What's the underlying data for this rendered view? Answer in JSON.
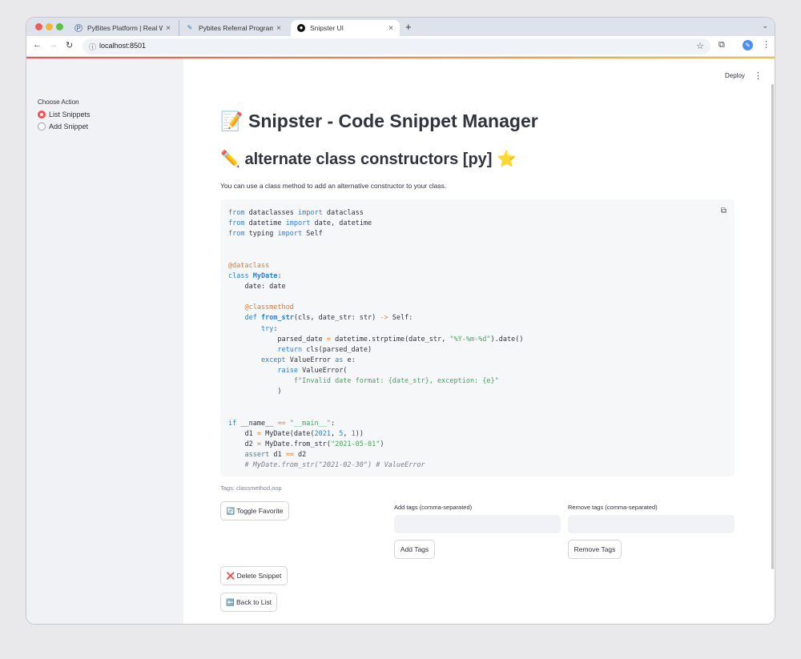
{
  "browser": {
    "tabs": [
      {
        "title": "PyBites Platform | Real World",
        "favicon": "pybites-logo-icon"
      },
      {
        "title": "Pybites Referral Program | Py",
        "favicon": "feather-icon"
      },
      {
        "title": "Snipster UI",
        "favicon": "github-icon"
      }
    ],
    "url": "localhost:8501",
    "icons": [
      "back-icon",
      "forward-icon",
      "reload-icon",
      "info-icon",
      "star-icon",
      "extensions-icon",
      "profile-icon",
      "menu-icon"
    ]
  },
  "sidebar": {
    "label": "Choose Action",
    "options": [
      {
        "label": "List Snippets",
        "selected": true
      },
      {
        "label": "Add Snippet",
        "selected": false
      }
    ]
  },
  "header": {
    "deploy_label": "Deploy"
  },
  "main": {
    "page_title": "📝 Snipster - Code Snippet Manager",
    "snippet_title": "✏️ alternate class constructors [py] ⭐",
    "description": "You can use a class method to add an alternative constructor to your class.",
    "code_lines": [
      "from dataclasses import dataclass",
      "from datetime import date, datetime",
      "from typing import Self",
      "",
      "",
      "@dataclass",
      "class MyDate:",
      "    date: date",
      "",
      "    @classmethod",
      "    def from_str(cls, date_str: str) -> Self:",
      "        try:",
      "            parsed_date = datetime.strptime(date_str, \"%Y-%m-%d\").date()",
      "            return cls(parsed_date)",
      "        except ValueError as e:",
      "            raise ValueError(",
      "                f\"Invalid date format: {date_str}, exception: {e}\"",
      "            )",
      "",
      "",
      "if __name__ == \"__main__\":",
      "    d1 = MyDate(date(2021, 5, 1))",
      "    d2 = MyDate.from_str(\"2021-05-01\")",
      "    assert d1 == d2",
      "    # MyDate.from_str(\"2021-02-30\") # ValueError"
    ],
    "tags_line": "Tags: classmethod,oop",
    "toggle_favorite_label": "🔄 Toggle Favorite",
    "add_tags_label": "Add tags (comma-separated)",
    "add_tags_value": "",
    "add_tags_button": "Add Tags",
    "remove_tags_label": "Remove tags (comma-separated)",
    "remove_tags_value": "",
    "remove_tags_button": "Remove Tags",
    "delete_label": "❌ Delete Snippet",
    "back_label": "⬅️ Back to List"
  },
  "colors": {
    "accent": "#ff4b4b",
    "keyword": "#2f7fd1",
    "string": "#3fa85a",
    "decorator": "#e07a2f",
    "comment": "#7a7f8c"
  }
}
